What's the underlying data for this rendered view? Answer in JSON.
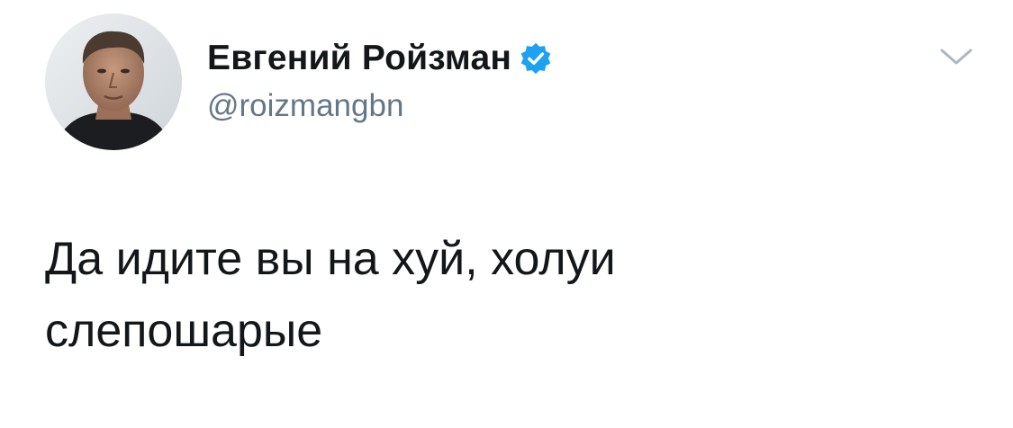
{
  "tweet": {
    "author": {
      "display_name": "Евгений Ройзман",
      "handle": "@roizmangbn",
      "verified": true,
      "avatar_icon": "user-photo"
    },
    "menu_icon": "chevron-down-icon",
    "text": "Да идите вы на хуй, холуи\nслепошарые"
  },
  "colors": {
    "text": "#14171a",
    "secondary_text": "#657786",
    "verified_badge": "#1da1f2",
    "caret": "#aab8c2",
    "background": "#ffffff"
  }
}
